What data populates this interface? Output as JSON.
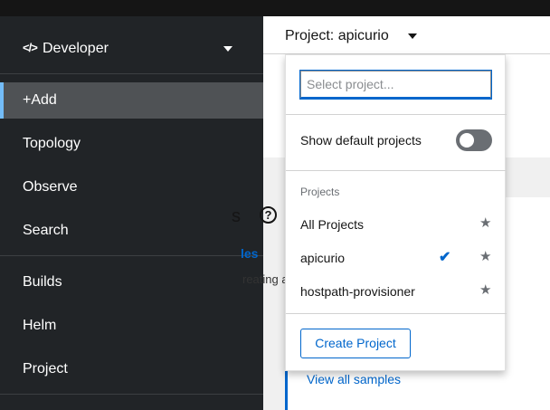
{
  "perspective": {
    "label": "Developer",
    "icon": "code-icon"
  },
  "nav": {
    "add": "+Add",
    "topology": "Topology",
    "observe": "Observe",
    "search": "Search",
    "builds": "Builds",
    "helm": "Helm",
    "project": "Project"
  },
  "project_selector": {
    "label": "Project: apicurio"
  },
  "dropdown": {
    "search_placeholder": "Select project...",
    "show_default_label": "Show default projects",
    "show_default_on": false,
    "group_label": "Projects",
    "items": [
      {
        "name": "All Projects",
        "selected": false
      },
      {
        "name": "apicurio",
        "selected": true
      },
      {
        "name": "hostpath-provisioner",
        "selected": false
      }
    ],
    "create_label": "Create Project"
  },
  "background": {
    "card_title_partial": "s",
    "help_icon": "?",
    "sample_link_partial": "les",
    "sample_text_partial": "reating a",
    "view_all": "View all samples"
  },
  "colors": {
    "accent": "#0066cc",
    "sidebar": "#212427",
    "active_nav": "#4f5255"
  }
}
